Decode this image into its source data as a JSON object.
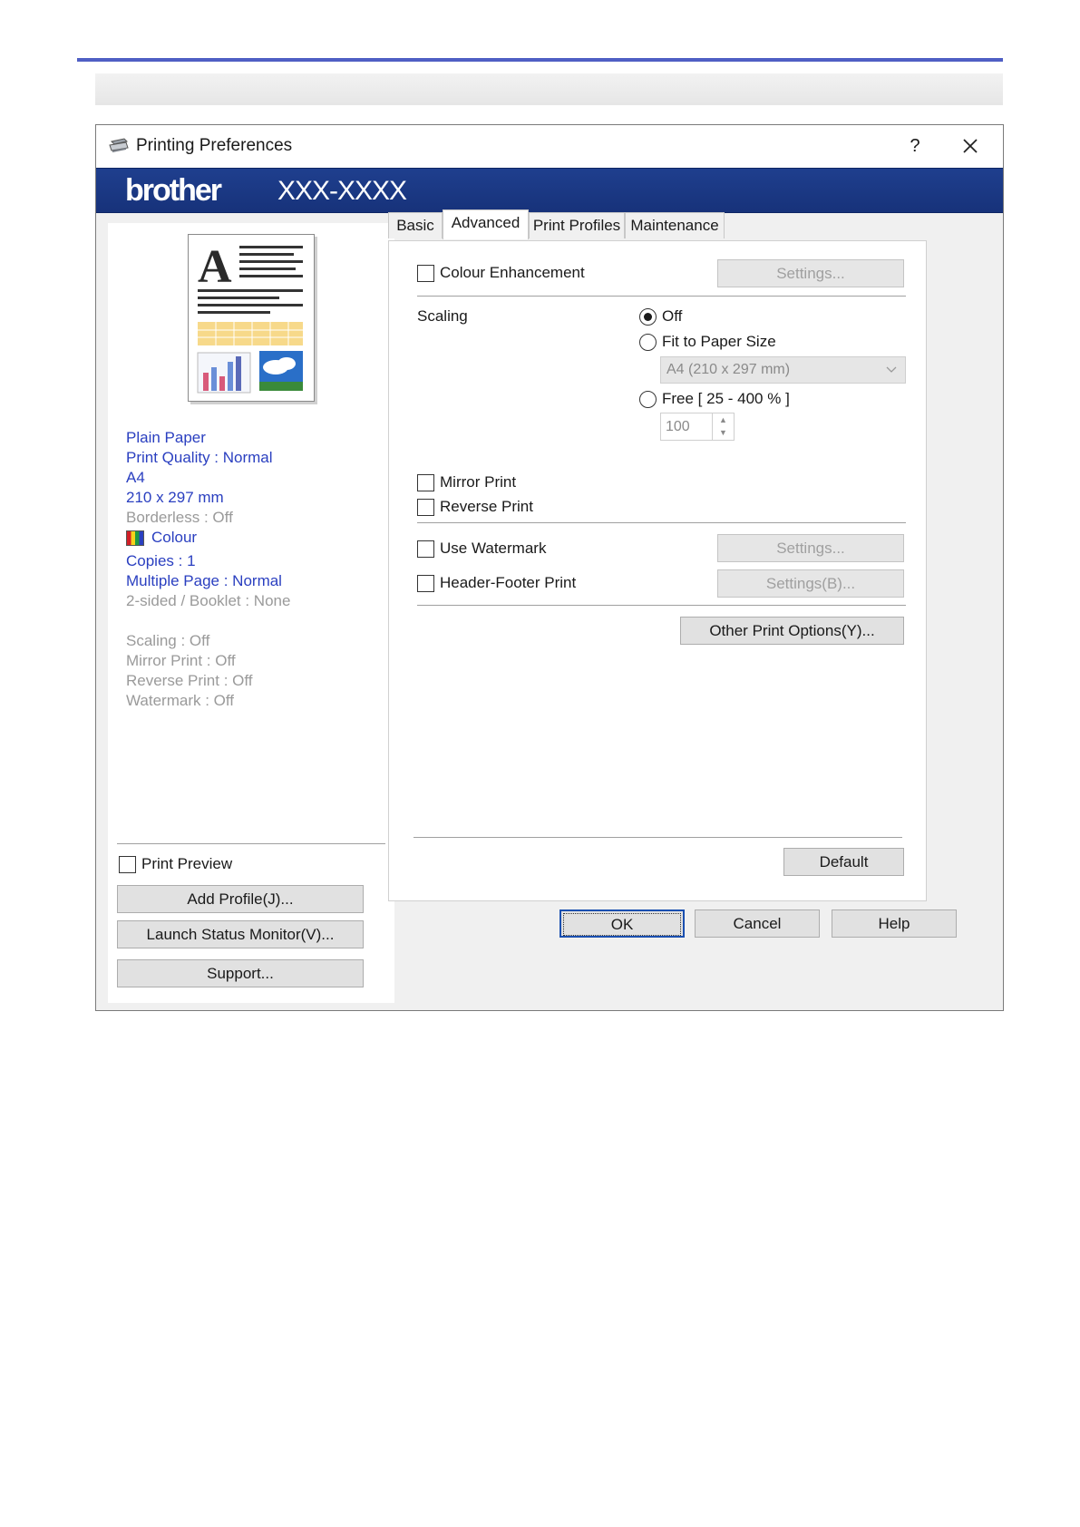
{
  "window": {
    "title": "Printing Preferences",
    "help_symbol": "?",
    "brand": "brother",
    "model": "XXX-XXXX"
  },
  "tabs": [
    {
      "label": "Basic"
    },
    {
      "label": "Advanced"
    },
    {
      "label": "Print Profiles"
    },
    {
      "label": "Maintenance"
    }
  ],
  "summary": {
    "media": "Plain Paper",
    "quality": "Print Quality : Normal",
    "paper": "A4",
    "size": "210 x 297 mm",
    "borderless": "Borderless : Off",
    "colour": "Colour",
    "copies": "Copies : 1",
    "multiple_page": "Multiple Page : Normal",
    "two_sided": "2-sided / Booklet : None",
    "scaling": "Scaling : Off",
    "mirror": "Mirror Print : Off",
    "reverse": "Reverse Print : Off",
    "watermark": "Watermark : Off"
  },
  "left": {
    "print_preview": "Print Preview",
    "add_profile": "Add Profile(J)...",
    "launch_status": "Launch Status Monitor(V)...",
    "support": "Support..."
  },
  "advanced": {
    "colour_enhancement": "Colour Enhancement",
    "settings": "Settings...",
    "scaling_label": "Scaling",
    "scale_off": "Off",
    "fit_to_paper": "Fit to Paper Size",
    "paper_select": "A4 (210 x 297 mm)",
    "free": "Free [ 25 - 400 % ]",
    "free_value": "100",
    "mirror_print": "Mirror Print",
    "reverse_print": "Reverse Print",
    "use_watermark": "Use Watermark",
    "watermark_settings": "Settings...",
    "header_footer": "Header-Footer Print",
    "header_footer_settings": "Settings(B)...",
    "other_options": "Other Print Options(Y)...",
    "default": "Default"
  },
  "footer": {
    "ok": "OK",
    "cancel": "Cancel",
    "help": "Help"
  },
  "colors": {
    "brand_bar": "#1f3f8e",
    "summary_text": "#2a3fc0",
    "page_rule": "#4f5fc4"
  }
}
